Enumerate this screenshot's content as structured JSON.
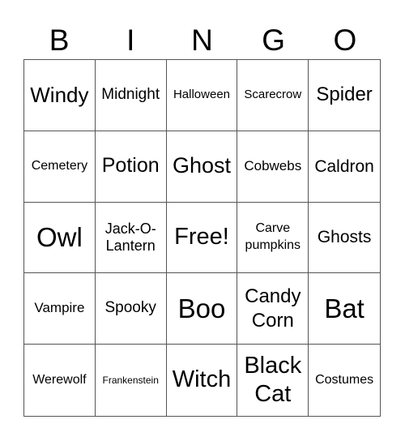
{
  "card": {
    "header": [
      "B",
      "I",
      "N",
      "G",
      "O"
    ],
    "rows": [
      [
        "Windy",
        "Midnight",
        "Halloween",
        "Scarecrow",
        "Spider"
      ],
      [
        "Cemetery",
        "Potion",
        "Ghost",
        "Cobwebs",
        "Caldron"
      ],
      [
        "Owl",
        "Jack-O-Lantern",
        "Free!",
        "Carve pumpkins",
        "Ghosts"
      ],
      [
        "Vampire",
        "Spooky",
        "Boo",
        "Candy Corn",
        "Bat"
      ],
      [
        "Werewolf",
        "Frankenstein",
        "Witch",
        "Black Cat",
        "Costumes"
      ]
    ],
    "free_space": "Free!",
    "colors": {
      "text": "#000000",
      "grid_line": "#555555",
      "background": "#ffffff"
    }
  }
}
